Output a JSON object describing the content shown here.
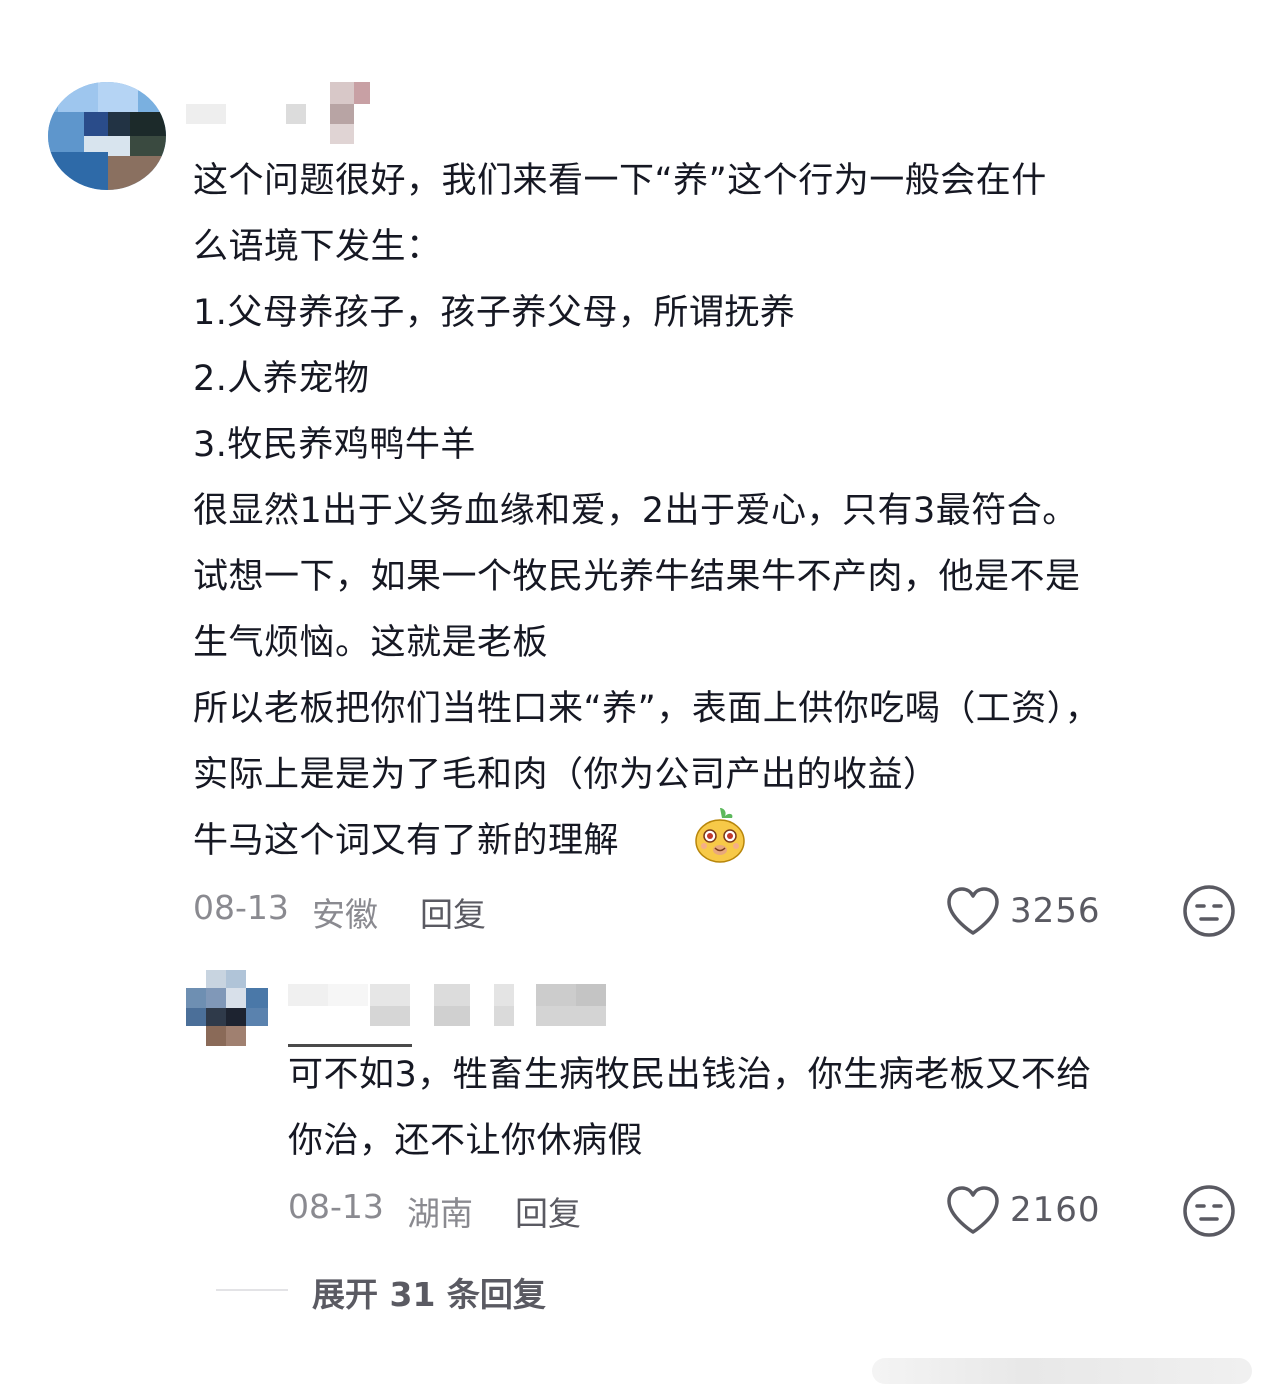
{
  "comment": {
    "lines": [
      "这个问题很好，我们来看一下“养”这个行为一般会在什",
      "么语境下发生：",
      "1.父母养孩子，孩子养父母，所谓抚养",
      "2.人养宠物",
      "3.牧民养鸡鸭牛羊",
      "很显然1出于义务血缘和爱，2出于爱心，只有3最符合。",
      "试想一下，如果一个牧民光养牛结果牛不产肉，他是不是",
      "生气烦恼。这就是老板",
      "所以老板把你们当牲口来“养”，表面上供你吃喝（工资），",
      "实际上是是为了毛和肉（你为公司产出的收益）",
      "牛马这个词又有了新的理解"
    ],
    "date": "08-13",
    "location": "安徽",
    "reply_label": "回复",
    "likes": "3256",
    "emoji_icon": "laughing-bear-emoji"
  },
  "reply": {
    "lines": [
      "可不如3，牲畜生病牧民出钱治，你生病老板又不给",
      "你治，还不让你休病假"
    ],
    "date": "08-13",
    "location": "湖南",
    "reply_label": "回复",
    "likes": "2160"
  },
  "expand": {
    "label": "展开 31 条回复"
  },
  "colors": {
    "text": "#161823",
    "meta": "#8a8a90",
    "secondary": "#5a5a62"
  }
}
